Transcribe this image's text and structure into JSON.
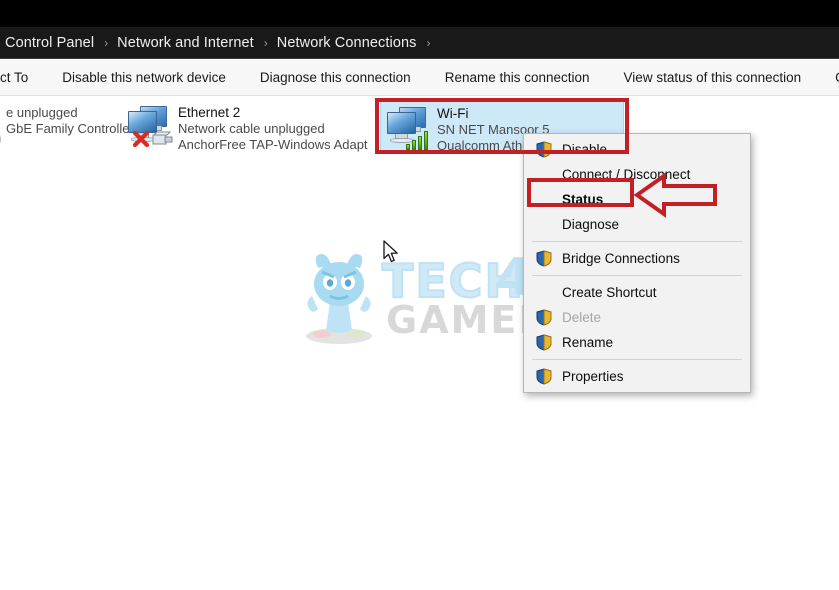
{
  "breadcrumb": {
    "name": "address-breadcrumb",
    "items": [
      "Control Panel",
      "Network and Internet",
      "Network Connections"
    ],
    "separator": "›",
    "trailing_separator": "›"
  },
  "toolbar": {
    "items": [
      "ct To",
      "Disable this network device",
      "Diagnose this connection",
      "Rename this connection",
      "View status of this connection",
      "Change settings of"
    ]
  },
  "connections": [
    {
      "name": "",
      "status": "e unplugged",
      "adapter": "GbE Family Controller",
      "icon": "network-adapter-disconnected-icon",
      "selected": false,
      "truncated_left": true
    },
    {
      "name": "Ethernet 2",
      "status": "Network cable unplugged",
      "adapter": "AnchorFree TAP-Windows Adapt...",
      "icon": "network-adapter-disconnected-icon",
      "selected": false,
      "truncated_left": false
    },
    {
      "name": "Wi-Fi",
      "status": "SN NET Mansoor 5",
      "adapter": "Qualcomm Athe",
      "icon": "wifi-adapter-connected-icon",
      "selected": true,
      "truncated_left": false
    }
  ],
  "context_menu": {
    "name": "wifi-context-menu",
    "items": [
      {
        "label": "Disable",
        "shield": true,
        "disabled": false,
        "bold": false,
        "separator_after": false
      },
      {
        "label": "Connect / Disconnect",
        "shield": false,
        "disabled": false,
        "bold": false,
        "separator_after": false
      },
      {
        "label": "Status",
        "shield": false,
        "disabled": false,
        "bold": true,
        "separator_after": false
      },
      {
        "label": "Diagnose",
        "shield": false,
        "disabled": false,
        "bold": false,
        "separator_after": true
      },
      {
        "label": "Bridge Connections",
        "shield": true,
        "disabled": false,
        "bold": false,
        "separator_after": true
      },
      {
        "label": "Create Shortcut",
        "shield": false,
        "disabled": false,
        "bold": false,
        "separator_after": false
      },
      {
        "label": "Delete",
        "shield": true,
        "disabled": true,
        "bold": false,
        "separator_after": false
      },
      {
        "label": "Rename",
        "shield": true,
        "disabled": false,
        "bold": false,
        "separator_after": true
      },
      {
        "label": "Properties",
        "shield": true,
        "disabled": false,
        "bold": false,
        "separator_after": false
      }
    ]
  },
  "annotations": {
    "highlight_color": "#c32026",
    "wifi_box_label": "wifi-connection-highlight",
    "status_box_label": "status-menu-item-highlight",
    "arrow_label": "pointer-arrow-to-status"
  },
  "watermark": {
    "line1": "TECH",
    "digit": "4",
    "line2": "GAMERS",
    "mascot": "tech4gamers-mascot"
  },
  "colors": {
    "selection": "#cde8f7",
    "breadcrumb_bg": "#191919",
    "toolbar_bg": "#f7f7f8",
    "menu_bg": "#f2f2f2",
    "signal_green": "#4d9b1b",
    "annotation_red": "#c32026"
  }
}
